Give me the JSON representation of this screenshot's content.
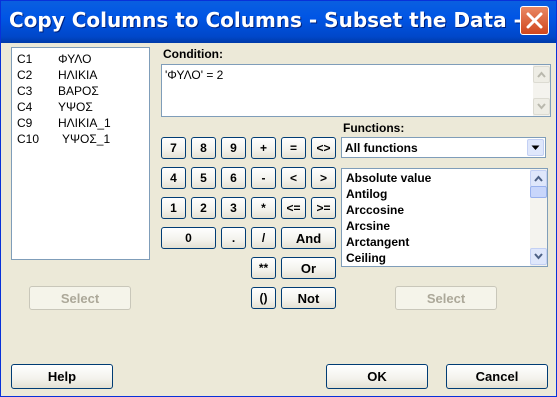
{
  "window": {
    "title": "Copy Columns to Columns - Subset the Data -..."
  },
  "columns": [
    {
      "id": "C1",
      "name": "ΦΥΛΟ"
    },
    {
      "id": "C2",
      "name": "ΗΛΙΚΙΑ"
    },
    {
      "id": "C3",
      "name": "ΒΑΡΟΣ"
    },
    {
      "id": "C4",
      "name": "ΥΨΟΣ"
    },
    {
      "id": "C9",
      "name": "ΗΛΙΚΙΑ_1"
    },
    {
      "id": "C10",
      "name": "ΥΨΟΣ_1"
    }
  ],
  "condition": {
    "label": "Condition:",
    "value": "'ΦΥΛΟ' = 2"
  },
  "keypad": {
    "k7": "7",
    "k8": "8",
    "k9": "9",
    "plus": "+",
    "eq": "=",
    "ne": "<>",
    "k4": "4",
    "k5": "5",
    "k6": "6",
    "minus": "-",
    "lt": "<",
    "gt": ">",
    "k1": "1",
    "k2": "2",
    "k3": "3",
    "mul": "*",
    "le": "<=",
    "ge": ">=",
    "k0": "0",
    "dot": ".",
    "div": "/",
    "and": "And",
    "pow": "**",
    "or": "Or",
    "paren": "()",
    "not": "Not"
  },
  "functions": {
    "label": "Functions:",
    "selected": "All functions",
    "items": [
      "Absolute value",
      "Antilog",
      "Arccosine",
      "Arcsine",
      "Arctangent",
      "Ceiling"
    ]
  },
  "buttons": {
    "select_left": "Select",
    "select_right": "Select",
    "help": "Help",
    "ok": "OK",
    "cancel": "Cancel"
  },
  "colors": {
    "titlebar": "#0055e5",
    "dialog": "#ece9d8",
    "close": "#d0461e"
  }
}
